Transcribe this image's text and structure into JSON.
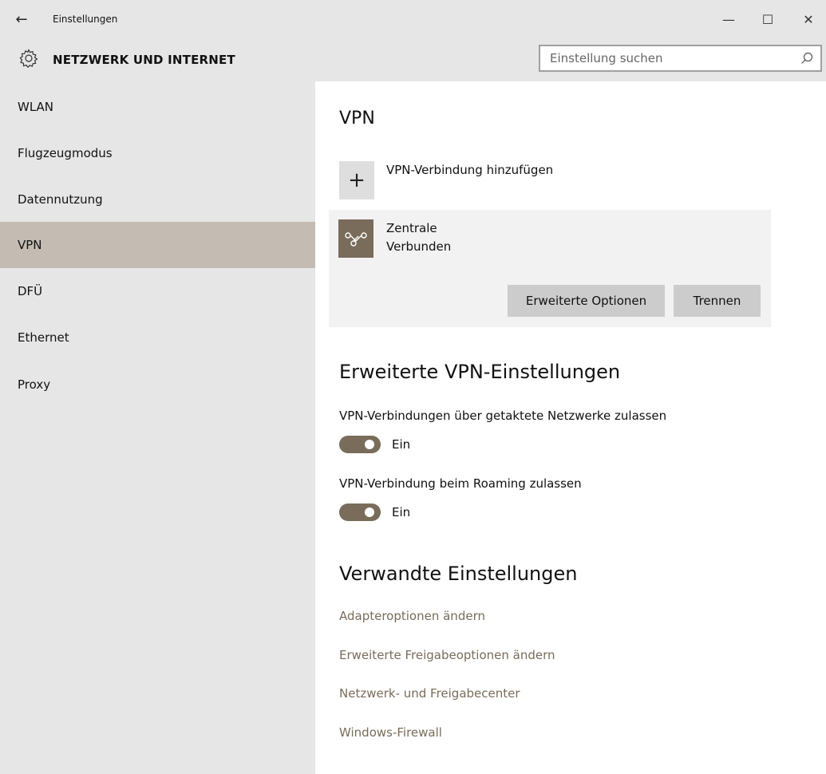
{
  "window": {
    "back_icon": "←",
    "title": "Einstellungen",
    "minimize_icon": "—",
    "maximize_icon": "☐",
    "close_icon": "✕"
  },
  "header": {
    "section_title": "NETZWERK UND INTERNET",
    "gear_icon": "gear-icon",
    "search_placeholder": "Einstellung suchen"
  },
  "sidebar": {
    "items": [
      {
        "label": "WLAN",
        "active": false
      },
      {
        "label": "Flugzeugmodus",
        "active": false
      },
      {
        "label": "Datennutzung",
        "active": false
      },
      {
        "label": "VPN",
        "active": true
      },
      {
        "label": "DFÜ",
        "active": false
      },
      {
        "label": "Ethernet",
        "active": false
      },
      {
        "label": "Proxy",
        "active": false
      }
    ]
  },
  "main": {
    "vpn_heading": "VPN",
    "add_icon": "+",
    "add_label": "VPN-Verbindung hinzufügen",
    "connection": {
      "name": "Zentrale",
      "status": "Verbunden",
      "advanced_button": "Erweiterte Optionen",
      "disconnect_button": "Trennen"
    },
    "advanced_heading": "Erweiterte VPN-Einstellungen",
    "options": [
      {
        "label": "VPN-Verbindungen über getaktete Netzwerke zulassen",
        "state": "Ein",
        "on": true
      },
      {
        "label": "VPN-Verbindung beim Roaming zulassen",
        "state": "Ein",
        "on": true
      }
    ],
    "related_heading": "Verwandte Einstellungen",
    "links": [
      "Adapteroptionen ändern",
      "Erweiterte Freigabeoptionen ändern",
      "Netzwerk- und Freigabecenter",
      "Windows-Firewall"
    ]
  },
  "colors": {
    "accent": "#796c5a",
    "chrome_bg": "#e6e6e6",
    "sidebar_active": "#c4bcb3",
    "card_bg": "#f2f2f2",
    "button_bg": "#cccccc"
  }
}
